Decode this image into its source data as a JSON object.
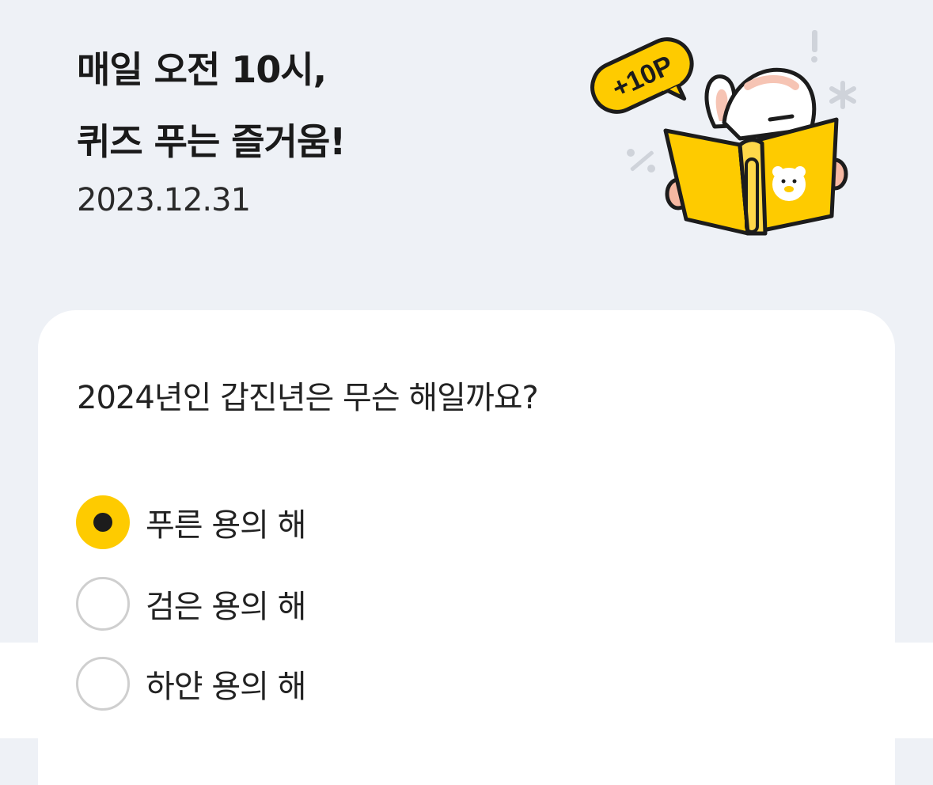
{
  "header": {
    "title_line1": "매일 오전 10시,",
    "title_line2": "퀴즈 푸는 즐거움!",
    "date": "2023.12.31",
    "badge_text": "+10P"
  },
  "quiz": {
    "question": "2024년인 갑진년은 무슨 해일까요?",
    "options": [
      {
        "label": "푸른 용의 해",
        "selected": true
      },
      {
        "label": "검은 용의 해",
        "selected": false
      },
      {
        "label": "하얀 용의 해",
        "selected": false
      }
    ]
  },
  "colors": {
    "background": "#eef1f6",
    "accent": "#fecb00",
    "card": "#ffffff",
    "radio_border": "#cfcfcf"
  },
  "icons": {
    "illustration": "rabbit-reading-book-icon",
    "badge": "speech-bubble-icon",
    "selected_radio": "radio-selected-icon",
    "unselected_radio": "radio-unselected-icon"
  }
}
